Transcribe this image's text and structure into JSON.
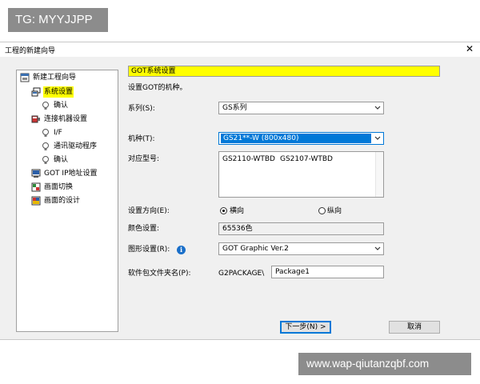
{
  "watermarks": {
    "top_left": "TG: MYYJJPP",
    "bottom_right": "www.wap-qiutanzqbf.com"
  },
  "window": {
    "title": "工程的新建向导"
  },
  "tree": {
    "items": [
      {
        "label": "新建工程向导",
        "icon": "wizard-icon"
      },
      {
        "label": "系统设置",
        "icon": "system-settings-icon",
        "selected": true
      },
      {
        "label": "确认",
        "icon": "bulb-icon"
      },
      {
        "label": "连接机器设置",
        "icon": "connection-icon"
      },
      {
        "label": "I/F",
        "icon": "bulb-icon"
      },
      {
        "label": "通讯驱动程序",
        "icon": "bulb-icon"
      },
      {
        "label": "确认",
        "icon": "bulb-icon"
      },
      {
        "label": "GOT IP地址设置",
        "icon": "network-icon"
      },
      {
        "label": "画面切换",
        "icon": "screen-switch-icon"
      },
      {
        "label": "画面的设计",
        "icon": "screen-design-icon"
      }
    ]
  },
  "panel": {
    "header": "GOT系统设置",
    "intro": "设置GOT的机种。",
    "series_label": "系列(S):",
    "series_value": "GS系列",
    "model_label": "机种(T):",
    "model_value": "GS21**-W (800x480)",
    "types_label": "对应型号:",
    "types": [
      "GS2110-WTBD",
      "GS2107-WTBD"
    ],
    "orientation_label": "设置方向(E):",
    "orientation_options": [
      "横向",
      "纵向"
    ],
    "orientation_selected": "横向",
    "color_label": "颜色设置:",
    "color_value": "65536色",
    "graphic_label": "图形设置(R):",
    "graphic_value": "GOT Graphic Ver.2",
    "package_label": "软件包文件夹名(P):",
    "package_prefix": "G2PACKAGE\\",
    "package_value": "Package1"
  },
  "buttons": {
    "next": "下一步(N) >",
    "cancel": "取消"
  },
  "colors": {
    "highlight": "#ffff00",
    "selection": "#0078d7",
    "info": "#1a6fc9"
  }
}
